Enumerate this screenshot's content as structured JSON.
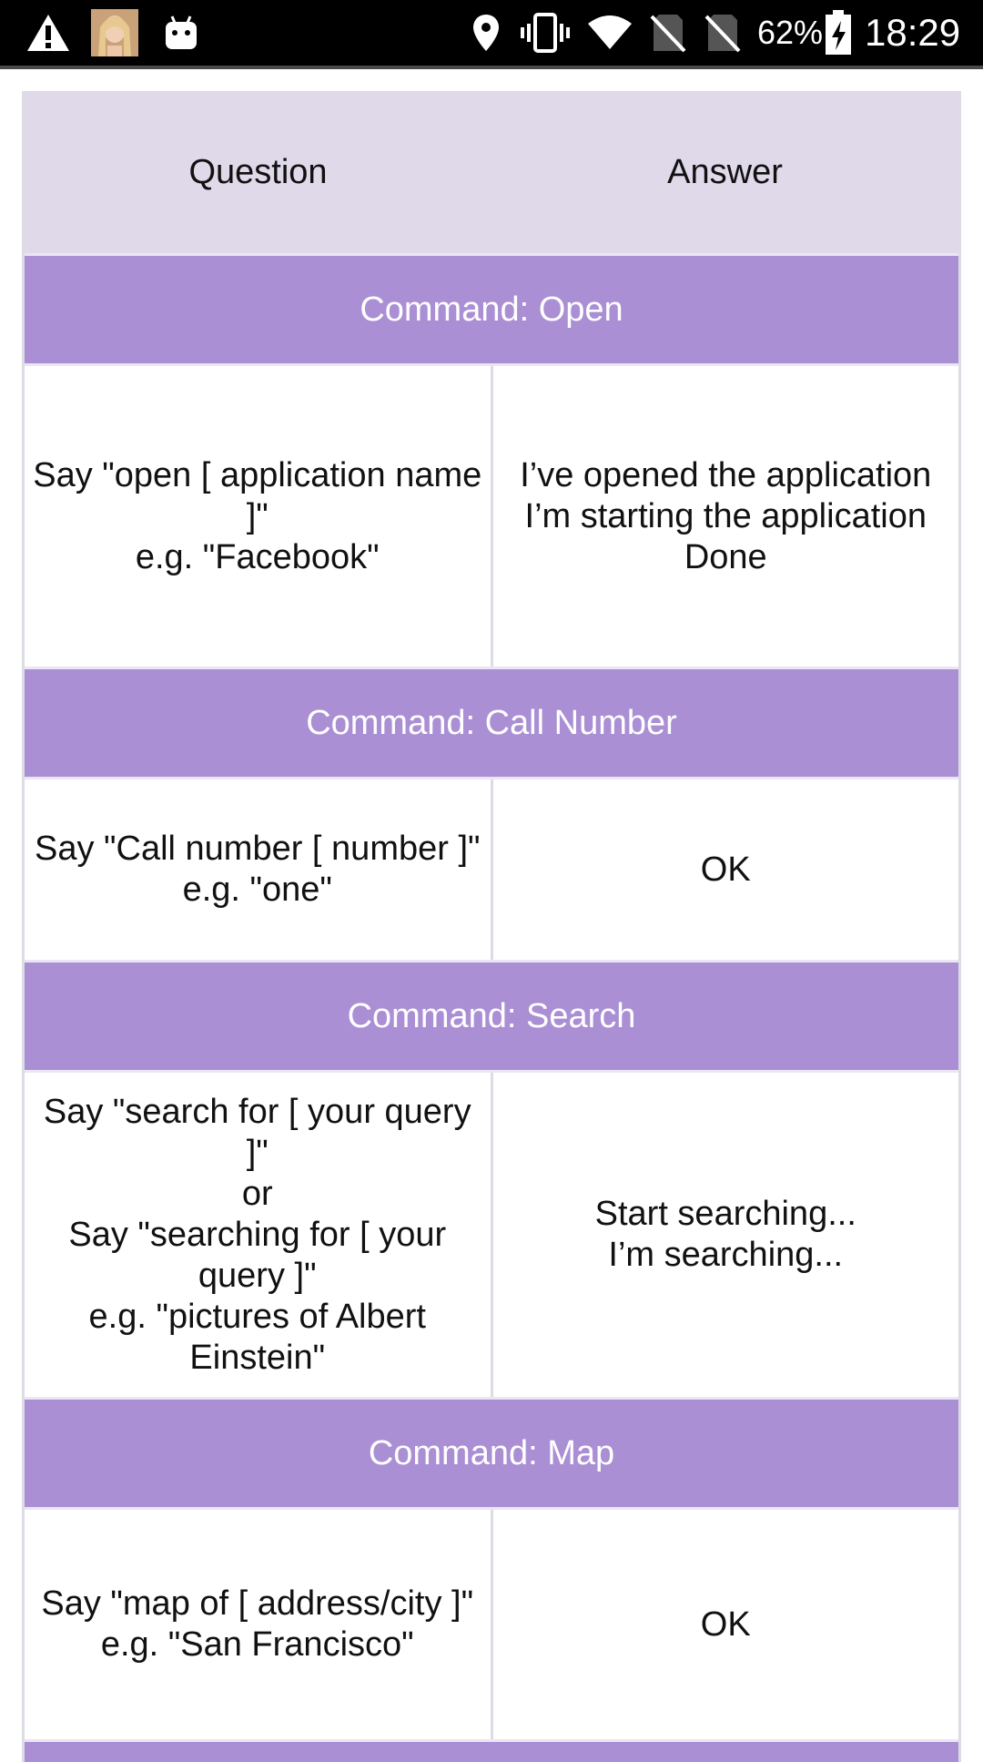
{
  "status_bar": {
    "battery_percent": "62%",
    "time": "18:29",
    "icons": [
      "warning-icon",
      "avatar",
      "android-icon",
      "location-icon",
      "vibrate-icon",
      "wifi-icon",
      "no-sim-icon",
      "no-sim-icon",
      "battery-charging-icon"
    ]
  },
  "colors": {
    "header_bg": "#dfd9ea",
    "command_bg": "#aa8fd4",
    "command_text": "#ffffff"
  },
  "table": {
    "headers": {
      "question": "Question",
      "answer": "Answer"
    },
    "sections": [
      {
        "command": "Command: Open",
        "question_lines": [
          "Say \"open [ application name",
          "]\"",
          "e.g. \"Facebook\""
        ],
        "answer_lines": [
          "I’ve opened the application",
          "I’m starting the application",
          "Done"
        ]
      },
      {
        "command": "Command: Call Number",
        "question_lines": [
          "Say \"Call number [ number ]\"",
          "e.g. \"one\""
        ],
        "answer_lines": [
          "OK"
        ]
      },
      {
        "command": "Command: Search",
        "question_lines": [
          "Say \"search for [ your query ]\"",
          "or",
          "Say \"searching for [ your",
          "query ]\"",
          "e.g. \"pictures of Albert",
          "Einstein\""
        ],
        "answer_lines": [
          "Start searching...",
          "I’m searching..."
        ]
      },
      {
        "command": "Command: Map",
        "question_lines": [
          "Say \"map of [ address/city ]\"",
          "e.g. \"San Francisco\""
        ],
        "answer_lines": [
          "OK"
        ]
      }
    ]
  }
}
